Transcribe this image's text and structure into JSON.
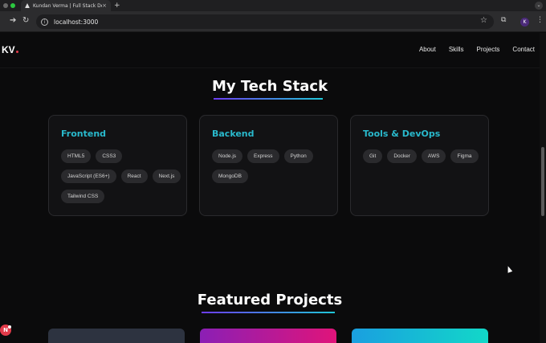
{
  "browser": {
    "tab_title": "Kundan Verma | Full Stack De",
    "tab_close": "×",
    "new_tab": "+",
    "url": "localhost:3000",
    "profile_initial": "K",
    "tab_menu": "⌄"
  },
  "navbar": {
    "logo": "KV",
    "links": [
      "About",
      "Skills",
      "Projects",
      "Contact"
    ]
  },
  "tech_stack": {
    "title": "My Tech Stack",
    "cards": [
      {
        "title": "Frontend",
        "chips": [
          "HTML5",
          "CSS3",
          "JavaScript (ES6+)",
          "React",
          "Next.js",
          "Tailwind CSS"
        ]
      },
      {
        "title": "Backend",
        "chips": [
          "Node.js",
          "Express",
          "Python",
          "MongoDB"
        ]
      },
      {
        "title": "Tools & DevOps",
        "chips": [
          "Git",
          "Docker",
          "AWS",
          "Figma"
        ]
      }
    ]
  },
  "projects": {
    "title": "Featured Projects"
  },
  "floating_badge": "N",
  "colors": {
    "accent_cyan": "#29b9cc",
    "gradient_start": "#6c3cf0",
    "gradient_end": "#1fc7d8",
    "background": "#0b0b0c"
  }
}
